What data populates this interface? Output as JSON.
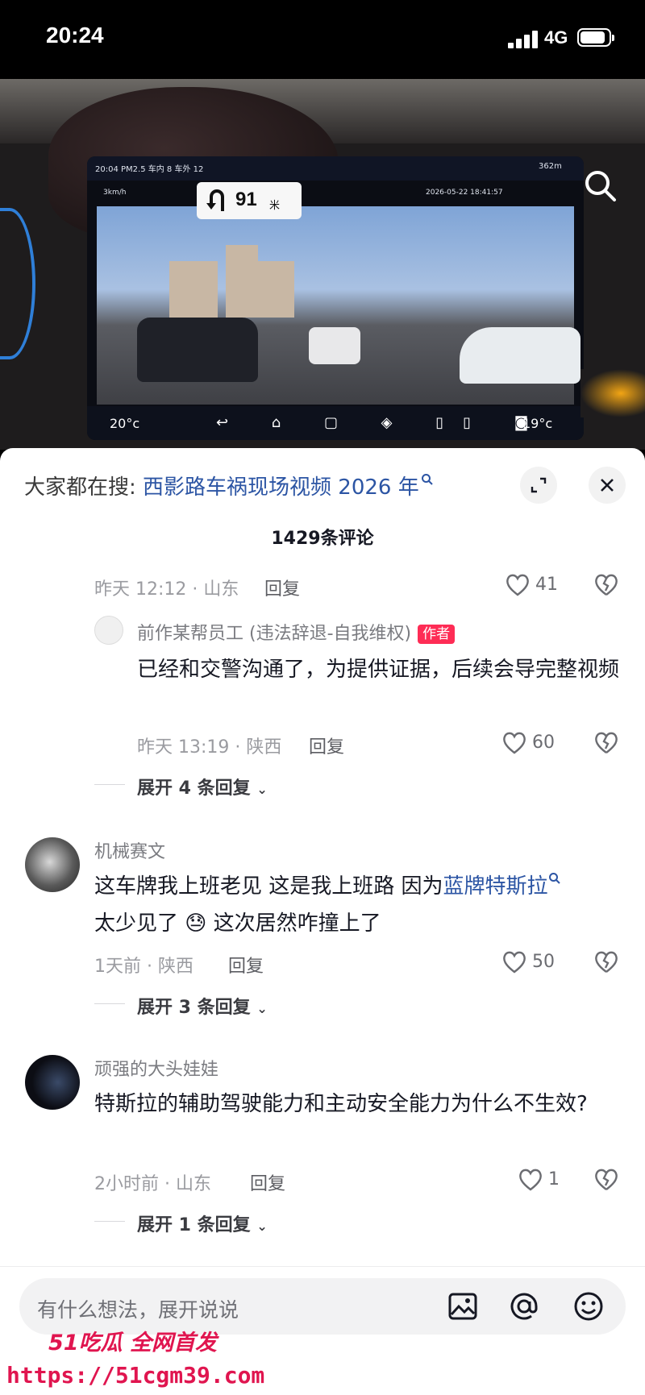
{
  "status_bar": {
    "time": "20:24",
    "network": "4G"
  },
  "video": {
    "screen_status": "20:04  PM2.5 车内 8  车外 12",
    "speed": "3km/h",
    "nav_distance": "91",
    "nav_unit": "米",
    "recording_time": "2026-05-22 18:41:57",
    "altitude": "362m",
    "temp_left": "20°c",
    "temp_right": "19°c"
  },
  "panel": {
    "hot_search_prefix": "大家都在搜: ",
    "hot_search_term": "西影路车祸现场视频 2026 年",
    "comment_count": "1429条评论"
  },
  "comments": [
    {
      "meta": "昨天 12:12 · 山东",
      "reply_label": "回复",
      "likes": "41"
    },
    {
      "username": "前作某帮员工 (违法辞退-自我维权)",
      "badge": "作者",
      "text": "已经和交警沟通了，为提供证据，后续会导完整视频",
      "meta": "昨天 13:19 · 陕西",
      "reply_label": "回复",
      "likes": "60",
      "expand": "展开 4 条回复"
    },
    {
      "username": "机械赛文",
      "text_a": "这车牌我上班老见 这是我上班路 因为",
      "link": "蓝牌特斯拉",
      "text_b": "太少见了",
      "emoji": "😓",
      "text_c": " 这次居然咋撞上了",
      "meta": "1天前 · 陕西",
      "reply_label": "回复",
      "likes": "50",
      "expand": "展开 3 条回复"
    },
    {
      "username": "顽强的大头娃娃",
      "text": "特斯拉的辅助驾驶能力和主动安全能力为什么不生效?",
      "meta": "2小时前 · 山东",
      "reply_label": "回复",
      "likes": "1",
      "expand": "展开 1 条回复"
    }
  ],
  "input": {
    "placeholder": "有什么想法，展开说说"
  },
  "watermark": {
    "logo": "51吃瓜 全网首发",
    "url": "https://51cgm39.com"
  },
  "colors": {
    "link": "#2c55a4",
    "badge": "#fe2c55",
    "watermark": "#e0154f"
  }
}
